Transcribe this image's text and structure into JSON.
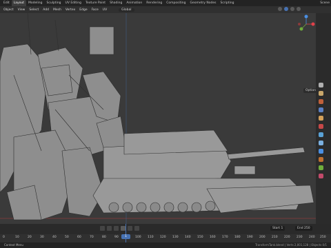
{
  "topbar": {
    "tabs": [
      "Layout",
      "Modeling",
      "Sculpting",
      "UV Editing",
      "Texture Paint",
      "Shading",
      "Animation",
      "Rendering",
      "Compositing",
      "Geometry Nodes",
      "Scripting"
    ],
    "scene": "Scene"
  },
  "header": {
    "menus": [
      "Object",
      "View",
      "Select",
      "Add",
      "Mesh",
      "Vertex",
      "Edge",
      "Face",
      "UV"
    ],
    "orientation": "Global"
  },
  "viewport": {
    "options_label": "Options",
    "gizmo_colors": {
      "x": "#e0414a",
      "y": "#6fad3c",
      "z": "#4a8fe3"
    }
  },
  "timeline": {
    "start_label": "Start",
    "start_value": "1",
    "end_label": "End",
    "end_value": "250",
    "current_frame": "1"
  },
  "frame_ruler": [
    "0",
    "10",
    "20",
    "30",
    "40",
    "50",
    "60",
    "70",
    "80",
    "90",
    "100",
    "110",
    "120",
    "130",
    "140",
    "150",
    "160",
    "170",
    "180",
    "190",
    "200",
    "210",
    "220",
    "230",
    "240",
    "250"
  ],
  "status": {
    "left": "Context Menu",
    "right": "TransformTank.blend | Verts 2,001,128 | Objects 0/1"
  }
}
